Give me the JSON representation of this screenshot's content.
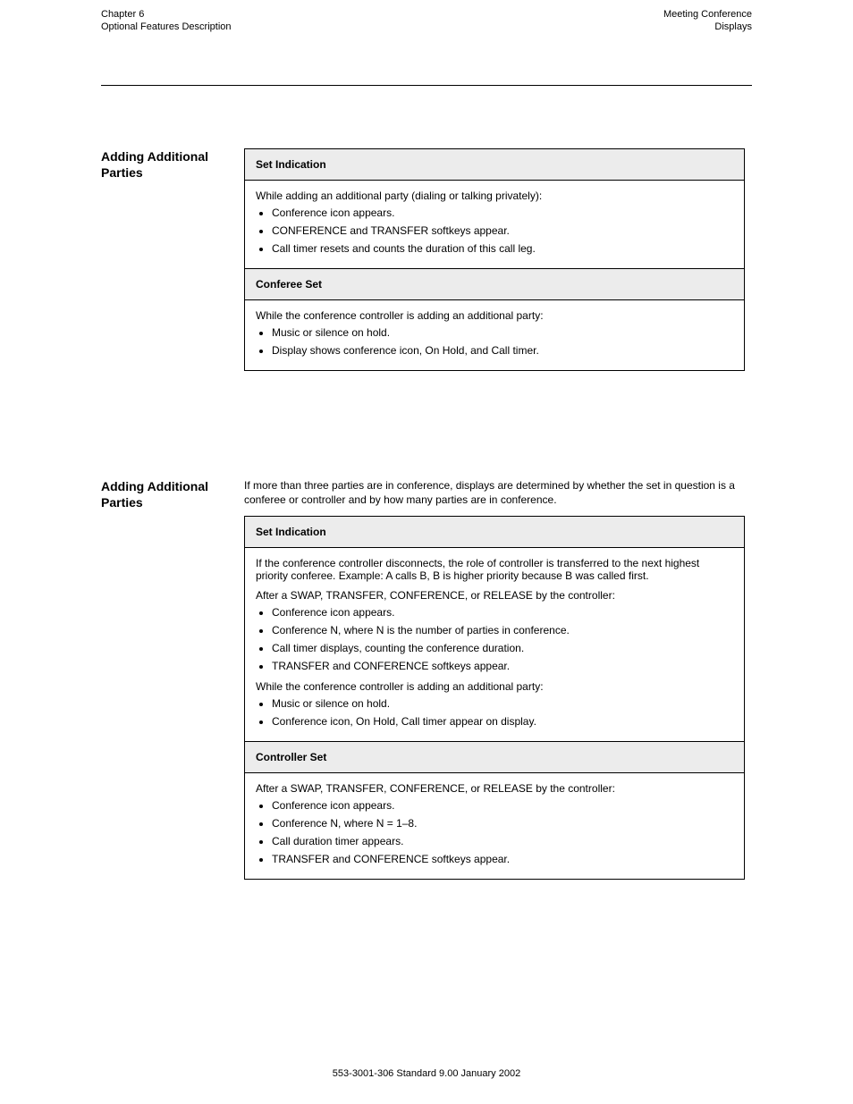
{
  "header": {
    "left_line1": "Chapter 6",
    "left_line2": "Optional Features Description",
    "right_line1": "Meeting Conference",
    "right_line2": "Displays"
  },
  "sections": [
    {
      "label": "Adding Additional Parties",
      "intro": null,
      "table": {
        "headers": [
          "Set Indication"
        ],
        "rows": [
          {
            "type": "data",
            "cells": [
              "While adding an additional party (dialing or talking privately):",
              [
                "Conference icon appears.",
                "CONFERENCE and TRANSFER softkeys appear.",
                "Call timer resets and counts the duration of this call leg."
              ]
            ]
          },
          {
            "type": "subhead",
            "cells": [
              "Conferee Set"
            ]
          },
          {
            "type": "data",
            "cells": [
              "While the conference controller is adding an additional party:",
              [
                "Music or silence on hold.",
                "Display shows conference icon, On Hold, and Call timer."
              ]
            ]
          }
        ]
      }
    },
    {
      "label": "Adding Additional Parties",
      "intro": "If more than three parties are in conference, displays are determined by whether the set in question is a conferee or controller and by how many parties are in conference.",
      "table": {
        "headers": [
          "Set Indication"
        ],
        "rows": [
          {
            "type": "data",
            "cells": [
              "If the conference controller disconnects, the role of controller is transferred to the next highest priority conferee. Example: A calls B, B is higher priority because B was called first.",
              null,
              "After a SWAP, TRANSFER, CONFERENCE, or RELEASE by the controller:",
              [
                "Conference icon appears.",
                "Conference N, where N is the number of parties in conference.",
                "Call timer displays, counting the conference duration.",
                "TRANSFER and CONFERENCE softkeys appear."
              ],
              "While the conference controller is adding an additional party:",
              [
                "Music or silence on hold.",
                "Conference icon, On Hold, Call timer appear on display."
              ]
            ]
          },
          {
            "type": "subhead",
            "cells": [
              "Controller Set"
            ]
          },
          {
            "type": "data",
            "cells": [
              "After a SWAP, TRANSFER, CONFERENCE, or RELEASE by the controller:",
              [
                "Conference icon appears.",
                "Conference N, where N = 1–8.",
                "Call duration timer appears.",
                "TRANSFER and CONFERENCE softkeys appear."
              ]
            ]
          }
        ]
      }
    }
  ],
  "page_number": "553-3001-306   Standard 9.00   January 2002"
}
